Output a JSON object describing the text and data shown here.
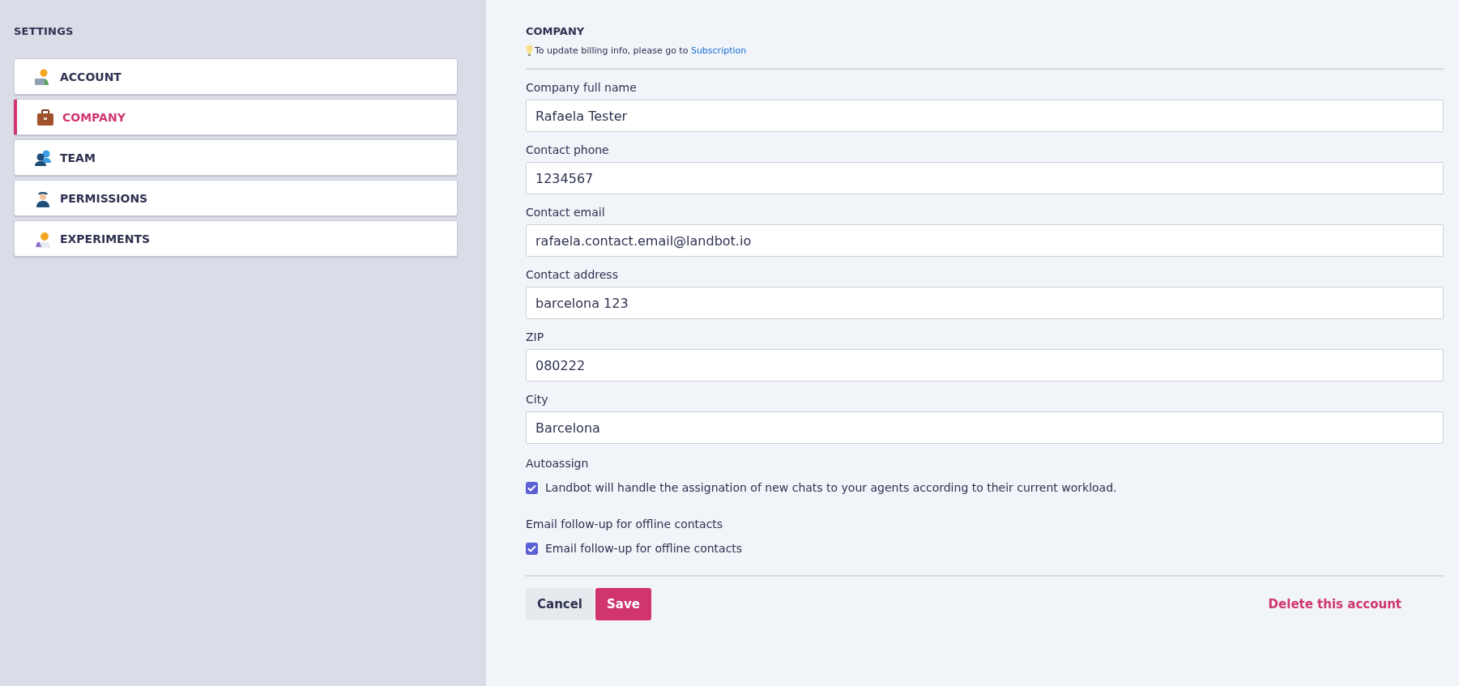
{
  "sidebar": {
    "title": "SETTINGS",
    "items": [
      {
        "label": "ACCOUNT",
        "kind": "account",
        "selected": false
      },
      {
        "label": "COMPANY",
        "kind": "company",
        "selected": true
      },
      {
        "label": "TEAM",
        "kind": "team",
        "selected": false
      },
      {
        "label": "PERMISSIONS",
        "kind": "permissions",
        "selected": false
      },
      {
        "label": "EXPERIMENTS",
        "kind": "experiments",
        "selected": false
      }
    ]
  },
  "main": {
    "title": "COMPANY",
    "hint": "To update billing info, please go to",
    "hint_link": "Subscription",
    "fields": [
      {
        "label": "Company full name",
        "value": "Rafaela Tester"
      },
      {
        "label": "Contact phone",
        "value": "1234567"
      },
      {
        "label": "Contact email",
        "value": "rafaela.contact.email@landbot.io"
      },
      {
        "label": "Contact address",
        "value": "barcelona 123"
      },
      {
        "label": "ZIP",
        "value": "080222"
      },
      {
        "label": "City",
        "value": "Barcelona"
      }
    ],
    "options": [
      {
        "heading": "Autoassign",
        "label": "Landbot will handle the assignation of new chats to your agents according to their current workload.",
        "checked": true
      },
      {
        "heading": "Email follow-up for offline contacts",
        "label": "Email follow-up for offline contacts",
        "checked": true
      }
    ],
    "buttons": {
      "cancel": "Cancel",
      "save": "Save",
      "delete": "Delete this account"
    }
  }
}
